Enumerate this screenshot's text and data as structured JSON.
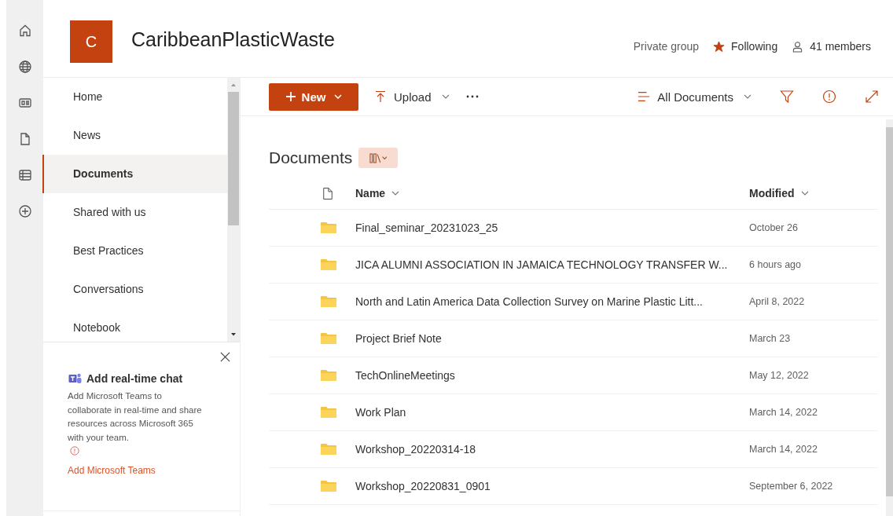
{
  "site": {
    "logo_letter": "C",
    "title": "CaribbeanPlasticWaste",
    "privacy": "Private group",
    "follow": {
      "label": "Following",
      "on": true
    },
    "members": "41 members"
  },
  "nav": {
    "items": [
      {
        "label": "Home",
        "selected": false
      },
      {
        "label": "News",
        "selected": false
      },
      {
        "label": "Documents",
        "selected": true
      },
      {
        "label": "Shared with us",
        "selected": false
      },
      {
        "label": "Best Practices",
        "selected": false
      },
      {
        "label": "Conversations",
        "selected": false
      },
      {
        "label": "Notebook",
        "selected": false
      }
    ]
  },
  "teams_card": {
    "title": "Add real-time chat",
    "body": "Add Microsoft Teams to collaborate in real-time and share resources across Microsoft 365 with your team.",
    "link": "Add Microsoft Teams"
  },
  "toolbar": {
    "new": "New",
    "upload": "Upload",
    "view": "All Documents"
  },
  "library": {
    "title": "Documents",
    "columns": [
      "Name",
      "Modified"
    ],
    "rows": [
      {
        "kind": "folder",
        "name": "Final_seminar_20231023_25",
        "modified": "October 26"
      },
      {
        "kind": "folder",
        "name": "JICA ALUMNI ASSOCIATION IN JAMAICA TECHNOLOGY TRANSFER W...",
        "modified": "6 hours ago"
      },
      {
        "kind": "folder",
        "name": "North and Latin America Data Collection Survey on Marine Plastic Litt...",
        "modified": "April 8, 2022"
      },
      {
        "kind": "folder",
        "name": "Project Brief Note",
        "modified": "March 23"
      },
      {
        "kind": "folder",
        "name": "TechOnlineMeetings",
        "modified": "May 12, 2022"
      },
      {
        "kind": "folder",
        "name": "Work Plan",
        "modified": "March 14, 2022"
      },
      {
        "kind": "folder",
        "name": "Workshop_20220314-18",
        "modified": "March 14, 2022"
      },
      {
        "kind": "folder",
        "name": "Workshop_20220831_0901",
        "modified": "September 6, 2022"
      }
    ]
  }
}
